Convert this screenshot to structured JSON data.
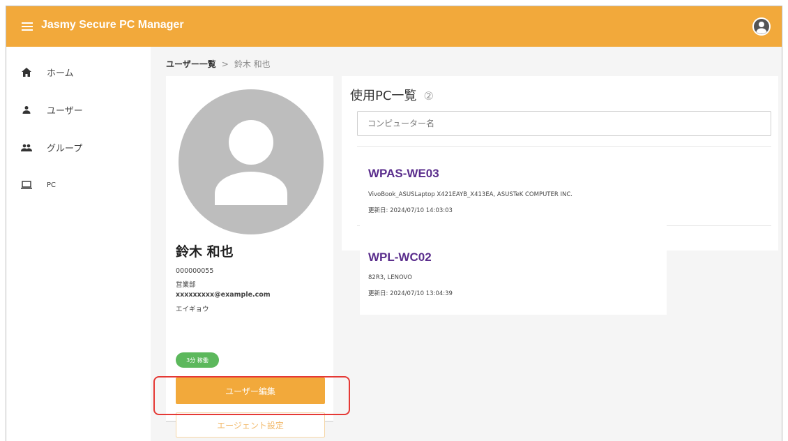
{
  "app": {
    "title": "Jasmy Secure PC Manager"
  },
  "sidebar": {
    "items": [
      {
        "label": "ホーム",
        "icon": "home-icon"
      },
      {
        "label": "ユーザー",
        "icon": "person-icon"
      },
      {
        "label": "グループ",
        "icon": "group-icon"
      },
      {
        "label": "PC",
        "icon": "laptop-icon"
      }
    ]
  },
  "breadcrumb": {
    "parent": "ユーザー一覧",
    "separator": ">",
    "current": "鈴木 和也"
  },
  "user": {
    "name": "鈴木 和也",
    "id": "000000055",
    "department": "営業部",
    "email": "xxxxxxxxx@example.com",
    "kana": "エイギョウ",
    "status": "3分 稼働",
    "edit_label": "ユーザー編集",
    "agent_label": "エージェント設定"
  },
  "pc_list": {
    "title": "使用PC一覧",
    "count": "②",
    "search_placeholder": "コンピューター名",
    "items": [
      {
        "name": "WPAS-WE03",
        "spec": "VivoBook_ASUSLaptop X421EAYB_X413EA, ASUSTeK COMPUTER INC.",
        "updated": "更新日: 2024/07/10 14:03:03"
      },
      {
        "name": "WPL-WC02",
        "spec": "82R3, LENOVO",
        "updated": "更新日: 2024/07/10 13:04:39"
      }
    ]
  },
  "colors": {
    "header": "#f2a93b",
    "accent_purple": "#5a2d8c",
    "status_green": "#5cb85c",
    "highlight_red": "#e53935"
  }
}
